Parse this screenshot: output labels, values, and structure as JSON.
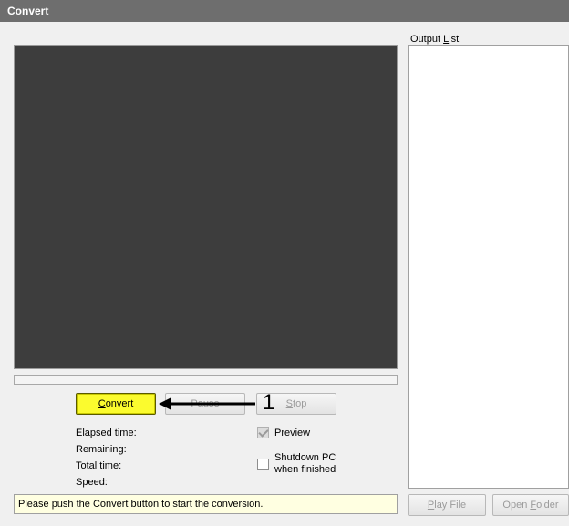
{
  "window": {
    "title": "Convert"
  },
  "buttons": {
    "convert_prefix": "",
    "convert_underlined": "C",
    "convert_rest": "onvert",
    "pause": "Pause",
    "stop_underlined": "S",
    "stop_rest": "top",
    "play_file_underlined": "P",
    "play_file_rest": "lay File",
    "open_folder_prefix": "Open ",
    "open_folder_underlined": "F",
    "open_folder_rest": "older"
  },
  "annotation": {
    "number": "1"
  },
  "stats": {
    "elapsed": "Elapsed time:",
    "remaining": "Remaining:",
    "total": "Total time:",
    "speed": "Speed:"
  },
  "options": {
    "preview": {
      "label": "Preview",
      "checked": true
    },
    "shutdown": {
      "label_line1": "Shutdown PC",
      "label_line2": "when finished",
      "checked": false
    }
  },
  "status": {
    "text": "Please push the Convert button to start the conversion."
  },
  "output_list": {
    "label_prefix": "Output ",
    "label_underlined": "L",
    "label_rest": "ist",
    "items": []
  },
  "progress": {
    "value": 0
  }
}
